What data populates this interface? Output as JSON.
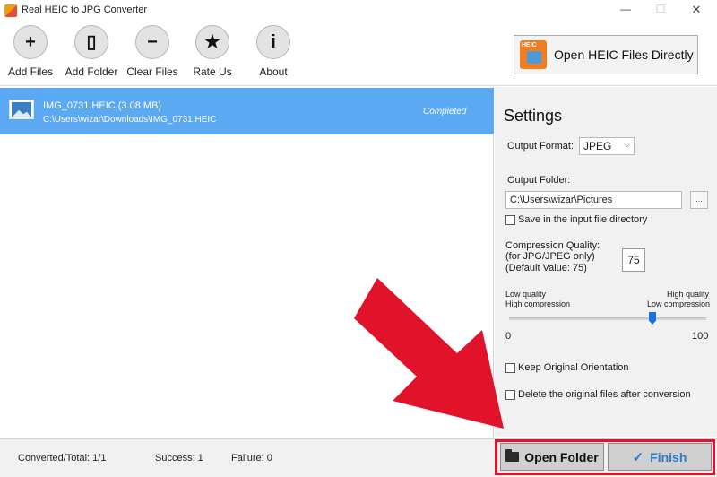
{
  "window": {
    "title": "Real HEIC to JPG Converter",
    "minimize": "—",
    "maximize": "☐",
    "close": "✕"
  },
  "toolbar": {
    "buttons": [
      {
        "label": "Add Files",
        "icon": "plus-icon",
        "glyph": "+"
      },
      {
        "label": "Add Folder",
        "icon": "folder-icon",
        "glyph": "▯"
      },
      {
        "label": "Clear Files",
        "icon": "minus-icon",
        "glyph": "−"
      },
      {
        "label": "Rate Us",
        "icon": "star-icon",
        "glyph": "★"
      },
      {
        "label": "About",
        "icon": "info-icon",
        "glyph": "i"
      }
    ],
    "open_heic": {
      "label": "Open HEIC Files Directly",
      "badge": "HEIC"
    }
  },
  "files": [
    {
      "name": "IMG_0731.HEIC (3.08 MB)",
      "path": "C:\\Users\\wizar\\Downloads\\IMG_0731.HEIC",
      "status": "Completed"
    }
  ],
  "settings": {
    "title": "Settings",
    "output_format_label": "Output Format:",
    "output_format_value": "JPEG",
    "output_folder_label": "Output Folder:",
    "output_folder_value": "C:\\Users\\wizar\\Pictures",
    "browse_label": "...",
    "save_in_input_label": "Save in the input file directory",
    "compression_label_1": "Compression Quality:",
    "compression_label_2": "(for JPG/JPEG only)",
    "compression_label_3": "(Default Value: 75)",
    "compression_value": "75",
    "low_quality": "Low quality",
    "high_compression": "High compression",
    "high_quality": "High quality",
    "low_compression": "Low compression",
    "slider_min": "0",
    "slider_max": "100",
    "slider_level": 75,
    "keep_orientation_label": "Keep Original Orientation",
    "delete_original_label": "Delete the original files after conversion"
  },
  "status": {
    "converted_total": "Converted/Total:  1/1",
    "success": "Success:  1",
    "failure": "Failure:  0"
  },
  "actions": {
    "open_folder": "Open Folder",
    "finish": "Finish"
  },
  "colors": {
    "selection": "#5aa9f2",
    "highlight_red": "#e0132a",
    "accent_blue": "#2b7bd0"
  }
}
